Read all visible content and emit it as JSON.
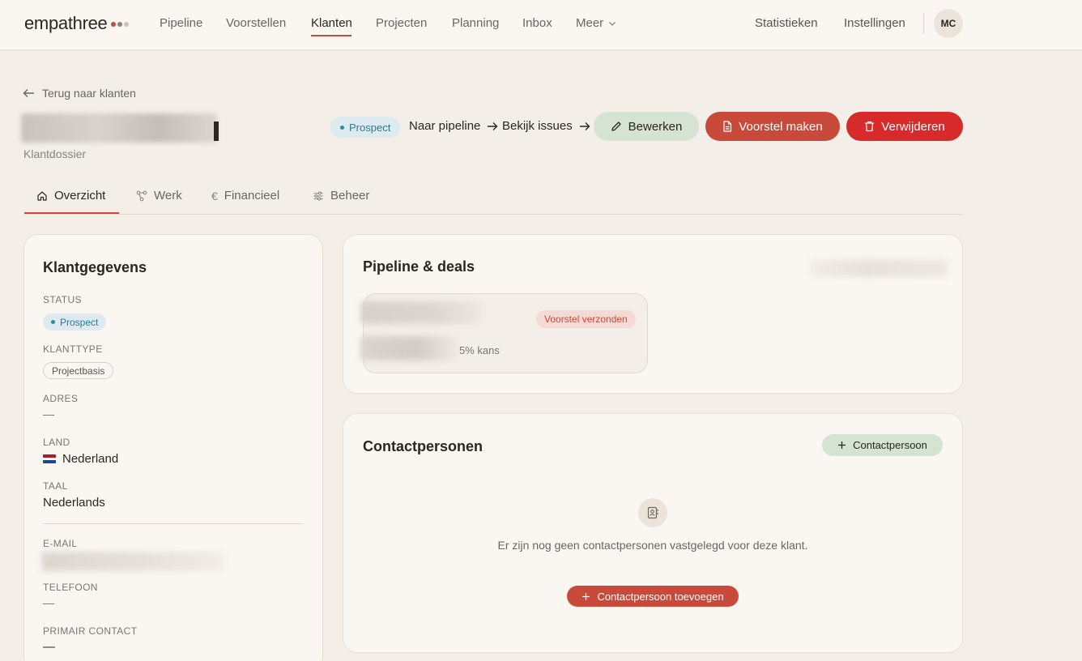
{
  "brand": {
    "name": "empathree",
    "dots": [
      "#c94a3a",
      "#8a847e",
      "#c9c3bd"
    ]
  },
  "nav": {
    "items": [
      "Pipeline",
      "Voorstellen",
      "Klanten",
      "Projecten",
      "Planning",
      "Inbox",
      "Meer"
    ],
    "active": "Klanten",
    "right": [
      "Statistieken",
      "Instellingen"
    ],
    "avatar": "MC"
  },
  "header": {
    "back_label": "Terug naar klanten",
    "subtitle": "Klantdossier",
    "status": "Prospect",
    "link_pipeline": "Naar pipeline",
    "link_issues": "Bekijk issues",
    "edit_label": "Bewerken",
    "proposal_label": "Voorstel maken",
    "delete_label": "Verwijderen"
  },
  "tabs": [
    {
      "label": "Overzicht",
      "icon": "home-icon"
    },
    {
      "label": "Werk",
      "icon": "workflow-icon"
    },
    {
      "label": "Financieel",
      "icon": "euro-icon"
    },
    {
      "label": "Beheer",
      "icon": "sliders-icon"
    }
  ],
  "client_card": {
    "title": "Klantgegevens",
    "status_label": "STATUS",
    "status_value": "Prospect",
    "type_label": "KLANTTYPE",
    "type_value": "Projectbasis",
    "address_label": "ADRES",
    "address_value": "—",
    "country_label": "LAND",
    "country_flag": "🇳🇱",
    "country_value": "Nederland",
    "language_label": "TAAL",
    "language_value": "Nederlands",
    "email_label": "E-MAIL",
    "phone_label": "TELEFOON",
    "phone_value": "—",
    "primary_label": "PRIMAIR CONTACT",
    "primary_value": "—"
  },
  "pipeline_card": {
    "title": "Pipeline & deals",
    "deal_status": "Voorstel verzonden",
    "deal_chance": "5% kans"
  },
  "contacts_card": {
    "title": "Contactpersonen",
    "add_small_label": "Contactpersoon",
    "empty_text": "Er zijn nog geen contactpersonen vastgelegd voor deze klant.",
    "add_label": "Contactpersoon toevoegen"
  }
}
